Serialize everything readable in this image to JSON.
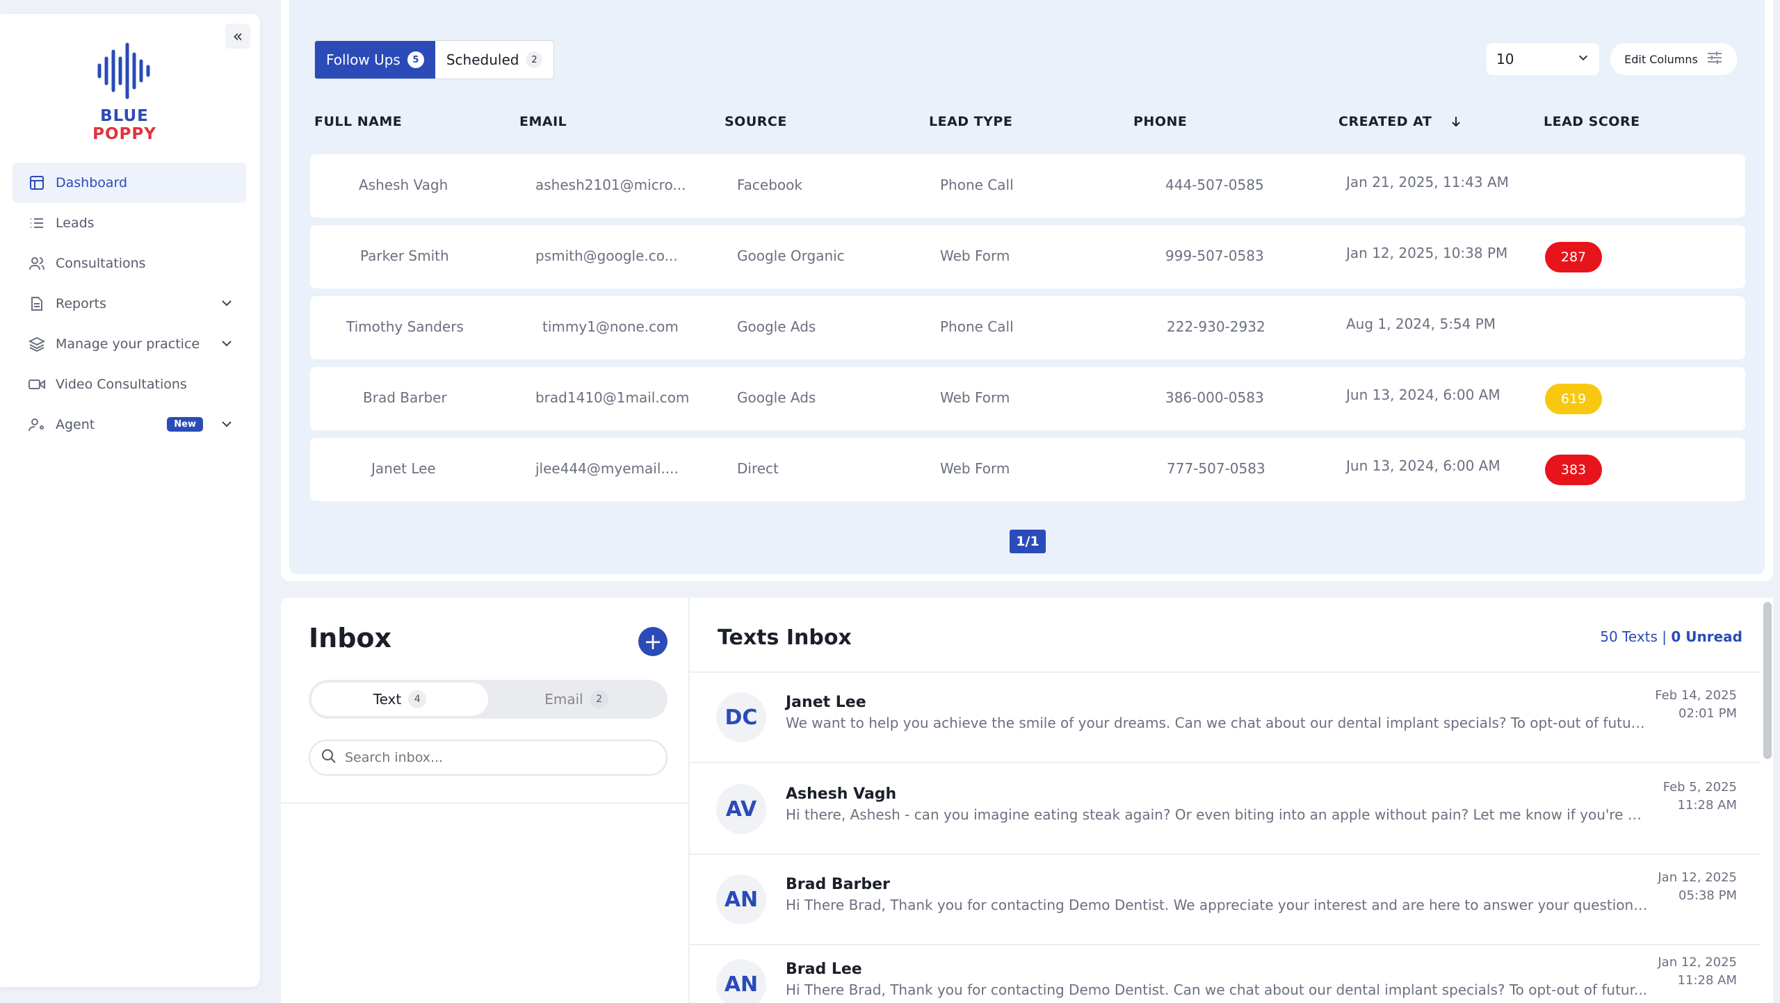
{
  "brand": {
    "word1": "BLUE",
    "word2": "POPPY"
  },
  "sidebar": {
    "items": [
      {
        "label": "Dashboard"
      },
      {
        "label": "Leads"
      },
      {
        "label": "Consultations"
      },
      {
        "label": "Reports"
      },
      {
        "label": "Manage your practice"
      },
      {
        "label": "Video Consultations"
      },
      {
        "label": "Agent",
        "badge": "New"
      }
    ]
  },
  "leads": {
    "tabs": [
      {
        "label": "Follow Ups",
        "count": "5"
      },
      {
        "label": "Scheduled",
        "count": "2"
      }
    ],
    "per_page": "10",
    "edit_columns": "Edit Columns",
    "columns": [
      "FULL NAME",
      "EMAIL",
      "SOURCE",
      "LEAD TYPE",
      "PHONE",
      "CREATED AT",
      "LEAD SCORE"
    ],
    "rows": [
      {
        "name": "Ashesh Vagh",
        "email": "ashesh2101@micro...",
        "source": "Facebook",
        "type": "Phone Call",
        "phone": "444-507-0585",
        "created": "Jan 21, 2025, 11:43 AM",
        "score": ""
      },
      {
        "name": "Parker Smith",
        "email": "psmith@google.co...",
        "source": "Google Organic",
        "type": "Web Form",
        "phone": "999-507-0583",
        "created": "Jan 12, 2025, 10:38 PM",
        "score": "287"
      },
      {
        "name": "Timothy Sanders",
        "email": "timmy1@none.com",
        "source": "Google Ads",
        "type": "Phone Call",
        "phone": "222-930-2932",
        "created": "Aug 1, 2024, 5:54 PM",
        "score": ""
      },
      {
        "name": "Brad Barber",
        "email": "brad1410@1mail.com",
        "source": "Google Ads",
        "type": "Web Form",
        "phone": "386-000-0583",
        "created": "Jun 13, 2024, 6:00 AM",
        "score": "619"
      },
      {
        "name": "Janet Lee",
        "email": "jlee444@myemail....",
        "source": "Direct",
        "type": "Web Form",
        "phone": "777-507-0583",
        "created": "Jun 13, 2024, 6:00 AM",
        "score": "383"
      }
    ],
    "score_colors": {
      "287": "#e8141b",
      "619": "#f7c80f",
      "383": "#e8141b"
    },
    "pager": "1/1"
  },
  "inbox": {
    "title": "Inbox",
    "seg": [
      {
        "label": "Text",
        "count": "4"
      },
      {
        "label": "Email",
        "count": "2"
      }
    ],
    "search_placeholder": "Search inbox..."
  },
  "texts": {
    "title": "Texts Inbox",
    "stats_total": "50 Texts",
    "stats_sep": " | ",
    "stats_unread": "0 Unread",
    "messages": [
      {
        "initials": "DC",
        "name": "Janet Lee",
        "text": "We want to help you achieve the smile of your dreams. Can we chat about our dental implant specials? To opt-out of futur...",
        "date": "Feb 14, 2025",
        "time": "02:01 PM"
      },
      {
        "initials": "AV",
        "name": "Ashesh Vagh",
        "text": "Hi there, Ashesh - can you imagine eating steak again? Or even biting into an apple without pain? Let me know if you're still...",
        "date": "Feb 5, 2025",
        "time": "11:28 AM"
      },
      {
        "initials": "AN",
        "name": "Brad Barber",
        "text": "Hi There Brad, Thank you for contacting Demo Dentist. We appreciate your interest and are here to answer your questions. ...",
        "date": "Jan 12, 2025",
        "time": "05:38 PM"
      },
      {
        "initials": "AN",
        "name": "Brad Lee",
        "text": "Hi There Brad, Thank you for contacting Demo Dentist. Can we chat about our dental implant specials? To opt-out of futur...",
        "date": "Jan 12, 2025",
        "time": "11:28 AM"
      }
    ]
  }
}
